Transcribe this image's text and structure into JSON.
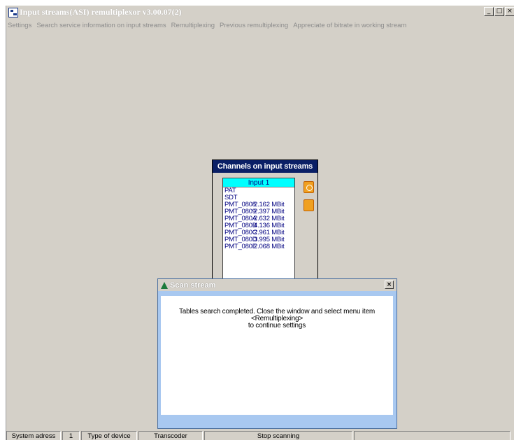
{
  "window": {
    "title": "Input streams(ASI)  remultiplexor  v3.00.07(2)",
    "controls": [
      "_",
      "□",
      "×"
    ]
  },
  "menu": [
    "Settings",
    "Search service information on input streams",
    "Remultiplexing",
    "Previous remultiplexing",
    "Appreciate of bitrate in working stream"
  ],
  "channels_panel": {
    "title": "Channels on input streams",
    "input_tab": "Input 1",
    "items": [
      {
        "name": "PAT",
        "rate": ""
      },
      {
        "name": "SDT",
        "rate": ""
      },
      {
        "name": "PMT_0808",
        "rate": "2.162 MBit"
      },
      {
        "name": "PMT_0809",
        "rate": "2.397 MBit"
      },
      {
        "name": "PMT_080A",
        "rate": "2.632 MBit"
      },
      {
        "name": "PMT_080B",
        "rate": "4.136 MBit"
      },
      {
        "name": "PMT_080C",
        "rate": "2.961 MBit"
      },
      {
        "name": "PMT_080D",
        "rate": "3.995 MBit"
      },
      {
        "name": "PMT_080E",
        "rate": "2.068 MBit"
      }
    ]
  },
  "dialog": {
    "title": "Scan stream",
    "close": "×",
    "lines": [
      "Tables search completed. Close the window and select menu item",
      "<Remultiplexing>",
      "to continue settings"
    ]
  },
  "status_bar": {
    "system_address_label": "System adress",
    "system_address_value": "1",
    "device_type_label": "Type of device",
    "device_type_value": "Transcoder",
    "stop_scanning": "Stop scanning"
  },
  "colors": {
    "panel_header": "#0a1f66",
    "input_tab": "#00ffff",
    "dialog_frame": "#a8c8f0",
    "side_buttons": "#f0a020"
  }
}
